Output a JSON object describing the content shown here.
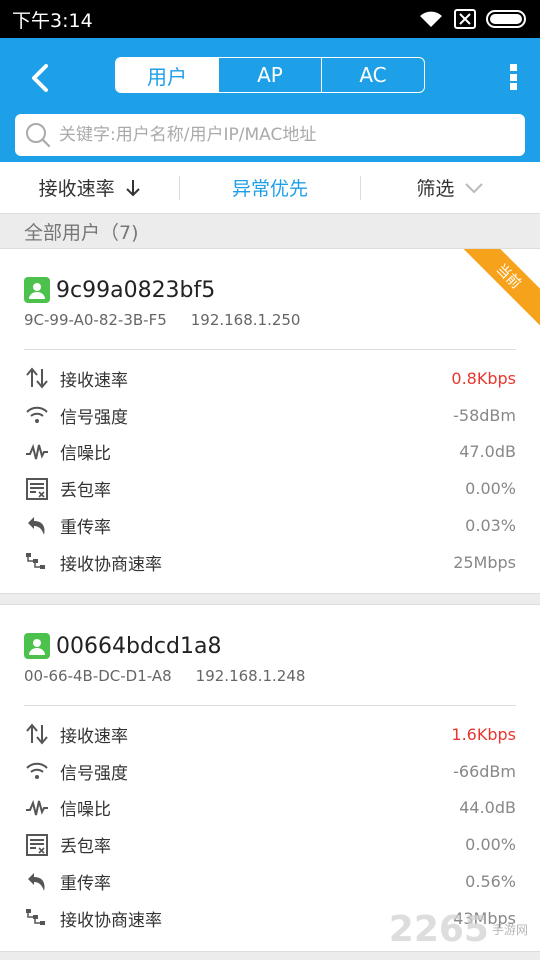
{
  "statusbar": {
    "time": "下午3:14"
  },
  "header": {
    "tabs": [
      {
        "label": "用户",
        "active": true
      },
      {
        "label": "AP",
        "active": false
      },
      {
        "label": "AC",
        "active": false
      }
    ],
    "search_placeholder": "关键字:用户名称/用户IP/MAC地址"
  },
  "filter": {
    "sort_label": "接收速率",
    "priority_label": "异常优先",
    "filter_label": "筛选"
  },
  "group": {
    "title": "全部用户（7)"
  },
  "devices": [
    {
      "badge": "当前",
      "name": "9c99a0823bf5",
      "mac": "9C-99-A0-82-3B-F5",
      "ip": "192.168.1.250",
      "metrics": [
        {
          "label": "接收速率",
          "value": "0.8Kbps"
        },
        {
          "label": "信号强度",
          "value": "-58dBm"
        },
        {
          "label": "信噪比",
          "value": "47.0dB"
        },
        {
          "label": "丢包率",
          "value": "0.00%"
        },
        {
          "label": "重传率",
          "value": "0.03%"
        },
        {
          "label": "接收协商速率",
          "value": "25Mbps"
        }
      ]
    },
    {
      "name": "00664bdcd1a8",
      "mac": "00-66-4B-DC-D1-A8",
      "ip": "192.168.1.248",
      "metrics": [
        {
          "label": "接收速率",
          "value": "1.6Kbps"
        },
        {
          "label": "信号强度",
          "value": "-66dBm"
        },
        {
          "label": "信噪比",
          "value": "44.0dB"
        },
        {
          "label": "丢包率",
          "value": "0.00%"
        },
        {
          "label": "重传率",
          "value": "0.56%"
        },
        {
          "label": "接收协商速率",
          "value": "43Mbps"
        }
      ]
    }
  ],
  "watermark": {
    "main": "2265",
    "sub": "手游网"
  },
  "colors": {
    "accent": "#1ea0e8",
    "alert": "#e8372e",
    "ribbon": "#f7a21b",
    "avatar": "#4cc24c"
  }
}
